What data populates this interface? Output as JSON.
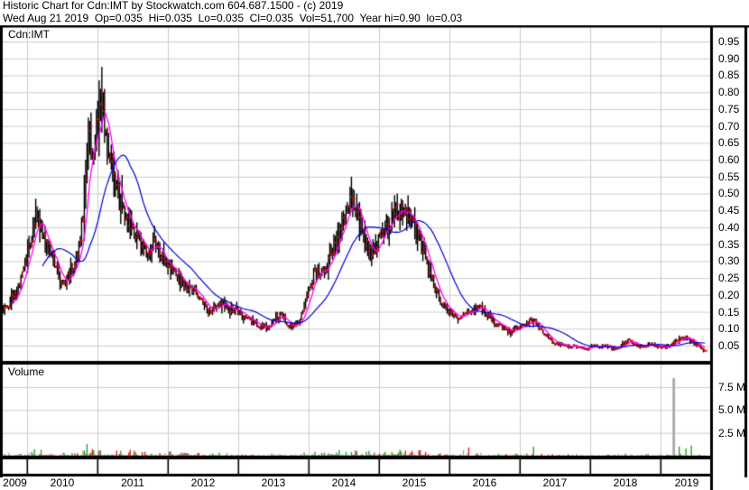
{
  "header": {
    "line1": "Historic Chart for Cdn:IMT by Stockwatch.com 604.687.1500 - (c) 2019",
    "line2": "Wed Aug 21 2019  Op=0.035  Hi=0.035  Lo=0.035  Cl=0.035  Vol=51,700  Year hi=0.90  lo=0.03"
  },
  "main_panel": {
    "symbol_label": "Cdn:IMT"
  },
  "volume_panel": {
    "label": "Volume"
  },
  "right_axis": {
    "price_ticks": [
      "0.95",
      "0.90",
      "0.85",
      "0.80",
      "0.75",
      "0.70",
      "0.65",
      "0.60",
      "0.55",
      "0.50",
      "0.45",
      "0.40",
      "0.35",
      "0.30",
      "0.25",
      "0.20",
      "0.15",
      "0.10",
      "0.05"
    ],
    "volume_ticks": [
      "7.5 M",
      "5.0 M",
      "2.5 M"
    ]
  },
  "x_axis": {
    "year_labels": [
      "2009",
      "2010",
      "2011",
      "2012",
      "2013",
      "2014",
      "2015",
      "2016",
      "2017",
      "2018",
      "2019"
    ]
  },
  "colors": {
    "bar": "#000000",
    "close_tick": "#ee0000",
    "ma_fast": "#ff00ff",
    "ma_slow": "#0000dd",
    "vol_up": "#2da12d",
    "vol_down": "#dd2020",
    "vol_flat": "#a8a8a8",
    "grid": "#cccccc",
    "border": "#000000",
    "text": "#000000",
    "bg": "#ffffff"
  },
  "chart_data": {
    "type": "ohlc",
    "interval": "weekly",
    "title": "Historic Chart for Cdn:IMT",
    "symbol": "Cdn:IMT",
    "last_quote": {
      "date": "Wed Aug 21 2019",
      "op": 0.035,
      "hi": 0.035,
      "lo": 0.035,
      "cl": 0.035,
      "vol": 51700,
      "year_hi": 0.9,
      "year_lo": 0.03
    },
    "price_axis": {
      "min": 0,
      "max": 0.975,
      "tick_step": 0.05,
      "tick_labels_from": 0.05,
      "tick_labels_to": 0.95
    },
    "volume_axis": {
      "ticks_millions": [
        2.5,
        5.0,
        7.5
      ],
      "max_millions": 9.5
    },
    "x_range": {
      "start": "2009-09",
      "end": "2019-08"
    },
    "grid": true,
    "legend_position": "none",
    "series": [
      {
        "name": "IMT weekly price bars",
        "style": "black high-low bars with red close ticks",
        "monthly_close_anchors": [
          [
            "2009-09",
            0.16
          ],
          [
            "2009-10",
            0.19
          ],
          [
            "2009-11",
            0.22
          ],
          [
            "2009-12",
            0.28
          ],
          [
            "2010-01",
            0.34
          ],
          [
            "2010-02",
            0.46
          ],
          [
            "2010-03",
            0.4
          ],
          [
            "2010-04",
            0.34
          ],
          [
            "2010-05",
            0.3
          ],
          [
            "2010-06",
            0.26
          ],
          [
            "2010-07",
            0.23
          ],
          [
            "2010-08",
            0.27
          ],
          [
            "2010-09",
            0.31
          ],
          [
            "2010-10",
            0.42
          ],
          [
            "2010-11",
            0.7
          ],
          [
            "2010-12",
            0.62
          ],
          [
            "2011-01",
            0.8
          ],
          [
            "2011-02",
            0.66
          ],
          [
            "2011-03",
            0.58
          ],
          [
            "2011-04",
            0.5
          ],
          [
            "2011-05",
            0.45
          ],
          [
            "2011-06",
            0.42
          ],
          [
            "2011-07",
            0.38
          ],
          [
            "2011-08",
            0.34
          ],
          [
            "2011-09",
            0.32
          ],
          [
            "2011-10",
            0.35
          ],
          [
            "2011-11",
            0.33
          ],
          [
            "2011-12",
            0.29
          ],
          [
            "2012-01",
            0.27
          ],
          [
            "2012-02",
            0.26
          ],
          [
            "2012-03",
            0.24
          ],
          [
            "2012-04",
            0.22
          ],
          [
            "2012-05",
            0.21
          ],
          [
            "2012-06",
            0.19
          ],
          [
            "2012-07",
            0.17
          ],
          [
            "2012-08",
            0.15
          ],
          [
            "2012-09",
            0.17
          ],
          [
            "2012-10",
            0.18
          ],
          [
            "2012-11",
            0.15
          ],
          [
            "2012-12",
            0.16
          ],
          [
            "2013-01",
            0.14
          ],
          [
            "2013-02",
            0.13
          ],
          [
            "2013-03",
            0.12
          ],
          [
            "2013-04",
            0.11
          ],
          [
            "2013-05",
            0.105
          ],
          [
            "2013-06",
            0.11
          ],
          [
            "2013-07",
            0.14
          ],
          [
            "2013-08",
            0.14
          ],
          [
            "2013-09",
            0.11
          ],
          [
            "2013-10",
            0.105
          ],
          [
            "2013-11",
            0.12
          ],
          [
            "2013-12",
            0.18
          ],
          [
            "2014-01",
            0.24
          ],
          [
            "2014-02",
            0.28
          ],
          [
            "2014-03",
            0.26
          ],
          [
            "2014-04",
            0.3
          ],
          [
            "2014-05",
            0.35
          ],
          [
            "2014-06",
            0.4
          ],
          [
            "2014-07",
            0.44
          ],
          [
            "2014-08",
            0.5
          ],
          [
            "2014-09",
            0.45
          ],
          [
            "2014-10",
            0.37
          ],
          [
            "2014-11",
            0.33
          ],
          [
            "2014-12",
            0.35
          ],
          [
            "2015-01",
            0.37
          ],
          [
            "2015-02",
            0.4
          ],
          [
            "2015-03",
            0.44
          ],
          [
            "2015-04",
            0.46
          ],
          [
            "2015-05",
            0.44
          ],
          [
            "2015-06",
            0.41
          ],
          [
            "2015-07",
            0.38
          ],
          [
            "2015-08",
            0.33
          ],
          [
            "2015-09",
            0.28
          ],
          [
            "2015-10",
            0.23
          ],
          [
            "2015-11",
            0.18
          ],
          [
            "2015-12",
            0.16
          ],
          [
            "2016-01",
            0.14
          ],
          [
            "2016-02",
            0.13
          ],
          [
            "2016-03",
            0.14
          ],
          [
            "2016-04",
            0.15
          ],
          [
            "2016-05",
            0.16
          ],
          [
            "2016-06",
            0.16
          ],
          [
            "2016-07",
            0.14
          ],
          [
            "2016-08",
            0.12
          ],
          [
            "2016-09",
            0.11
          ],
          [
            "2016-10",
            0.1
          ],
          [
            "2016-11",
            0.09
          ],
          [
            "2016-12",
            0.1
          ],
          [
            "2017-01",
            0.11
          ],
          [
            "2017-02",
            0.12
          ],
          [
            "2017-03",
            0.125
          ],
          [
            "2017-04",
            0.1
          ],
          [
            "2017-05",
            0.08
          ],
          [
            "2017-06",
            0.06
          ],
          [
            "2017-07",
            0.055
          ],
          [
            "2017-08",
            0.05
          ],
          [
            "2017-09",
            0.045
          ],
          [
            "2017-10",
            0.05
          ],
          [
            "2017-11",
            0.045
          ],
          [
            "2017-12",
            0.04
          ],
          [
            "2018-01",
            0.05
          ],
          [
            "2018-02",
            0.045
          ],
          [
            "2018-03",
            0.05
          ],
          [
            "2018-04",
            0.045
          ],
          [
            "2018-05",
            0.04
          ],
          [
            "2018-06",
            0.055
          ],
          [
            "2018-07",
            0.065
          ],
          [
            "2018-08",
            0.055
          ],
          [
            "2018-09",
            0.045
          ],
          [
            "2018-10",
            0.05
          ],
          [
            "2018-11",
            0.055
          ],
          [
            "2018-12",
            0.045
          ],
          [
            "2019-01",
            0.045
          ],
          [
            "2019-02",
            0.05
          ],
          [
            "2019-03",
            0.06
          ],
          [
            "2019-04",
            0.075
          ],
          [
            "2019-05",
            0.07
          ],
          [
            "2019-06",
            0.06
          ],
          [
            "2019-07",
            0.05
          ],
          [
            "2019-08",
            0.035
          ]
        ]
      },
      {
        "name": "MA fast",
        "type": "line",
        "color_key": "ma_fast",
        "period_weeks": 8
      },
      {
        "name": "MA slow",
        "type": "line",
        "color_key": "ma_slow",
        "period_weeks": 30
      }
    ],
    "volume_spikes_millions": [
      [
        "2010-01",
        0.25,
        "flat"
      ],
      [
        "2010-02",
        0.7,
        "up"
      ],
      [
        "2010-07",
        0.3,
        "up"
      ],
      [
        "2010-11",
        1.3,
        "up"
      ],
      [
        "2010-12",
        0.6,
        "up"
      ],
      [
        "2011-01",
        0.55,
        "down"
      ],
      [
        "2011-06",
        0.35,
        "down"
      ],
      [
        "2012-06",
        0.3,
        "down"
      ],
      [
        "2013-12",
        0.35,
        "up"
      ],
      [
        "2014-08",
        0.4,
        "up"
      ],
      [
        "2015-04",
        0.35,
        "up"
      ],
      [
        "2016-03",
        0.6,
        "flat"
      ],
      [
        "2016-04",
        0.9,
        "down"
      ],
      [
        "2017-03",
        1.0,
        "up"
      ],
      [
        "2019-03",
        8.5,
        "flat"
      ],
      [
        "2019-04",
        1.0,
        "up"
      ],
      [
        "2019-05",
        0.8,
        "up"
      ],
      [
        "2019-06",
        1.1,
        "up"
      ]
    ]
  }
}
